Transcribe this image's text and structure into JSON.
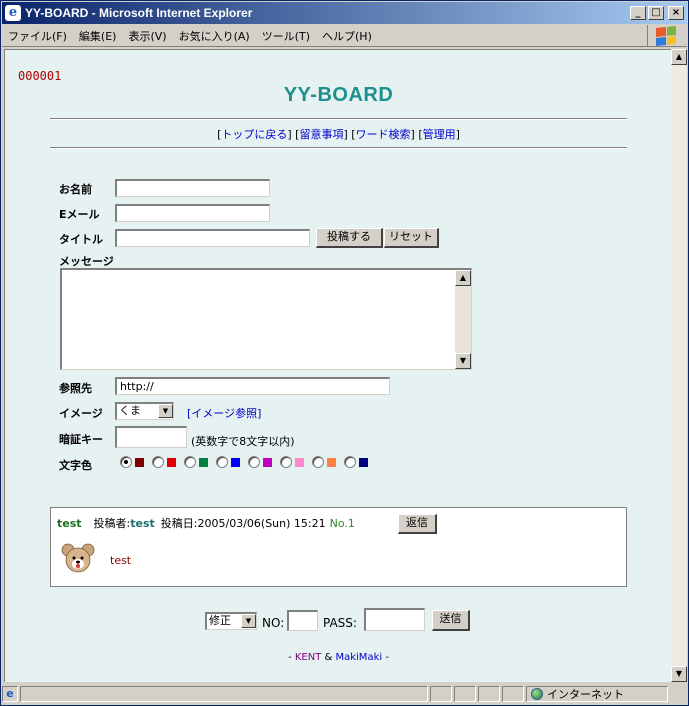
{
  "window": {
    "title": "YY-BOARD - Microsoft Internet Explorer"
  },
  "menu": [
    "ファイル(F)",
    "編集(E)",
    "表示(V)",
    "お気に入り(A)",
    "ツール(T)",
    "ヘルプ(H)"
  ],
  "page": {
    "counter": "000001",
    "title": "YY-BOARD",
    "nav": {
      "open": "[",
      "top": "トップに戻る",
      "sep": "] [",
      "notes": "留意事項",
      "search": "ワード検索",
      "admin": "管理用",
      "close": "]"
    }
  },
  "form": {
    "name_label": "お名前",
    "email_label": "Eメール",
    "title_label": "タイトル",
    "submit_button": "投稿する",
    "reset_button": "リセット",
    "message_label": "メッセージ",
    "ref_label": "参照先",
    "ref_value": "http://",
    "image_label": "イメージ",
    "image_selected": "くま",
    "image_ref_link": "[イメージ参照]",
    "key_label": "暗証キー",
    "key_hint": "(英数字で8文字以内)",
    "color_label": "文字色",
    "colors": [
      "#800000",
      "#e00000",
      "#008040",
      "#0000ff",
      "#c000c0",
      "#ff88cc",
      "#ff8040",
      "#000080"
    ],
    "selected_color_index": 0
  },
  "post": {
    "subject": "test",
    "author_label": "投稿者:",
    "author": "test",
    "date_label": "投稿日:",
    "date": "2005/03/06(Sun) 15:21",
    "no": "No.1",
    "reply_button": "返信",
    "body": "test"
  },
  "edit": {
    "mode": "修正",
    "no_label": "NO:",
    "pass_label": "PASS:",
    "send_button": "送信"
  },
  "footer": {
    "prefix": "- ",
    "kent": "KENT",
    "amp": " & ",
    "maki": "MakiMaki",
    "suffix": " -"
  },
  "status": {
    "zone": "インターネット"
  }
}
